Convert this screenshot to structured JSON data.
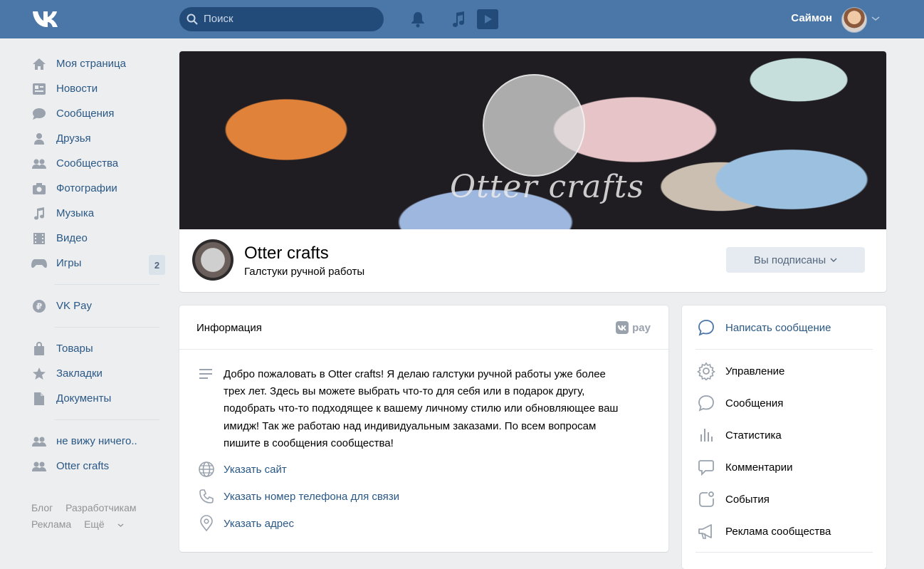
{
  "topbar": {
    "search_placeholder": "Поиск",
    "user_name": "Саймон"
  },
  "sidebar": {
    "items": [
      {
        "label": "Моя страница",
        "icon": "home-icon"
      },
      {
        "label": "Новости",
        "icon": "news-icon"
      },
      {
        "label": "Сообщения",
        "icon": "messages-icon"
      },
      {
        "label": "Друзья",
        "icon": "friend-icon"
      },
      {
        "label": "Сообщества",
        "icon": "groups-icon"
      },
      {
        "label": "Фотографии",
        "icon": "camera-icon"
      },
      {
        "label": "Музыка",
        "icon": "music-icon"
      },
      {
        "label": "Видео",
        "icon": "video-icon"
      },
      {
        "label": "Игры",
        "icon": "gamepad-icon",
        "badge": "2"
      }
    ],
    "pay": {
      "label": "VK Pay",
      "icon": "vkpay-icon"
    },
    "items2": [
      {
        "label": "Товары",
        "icon": "bag-icon"
      },
      {
        "label": "Закладки",
        "icon": "star-icon"
      },
      {
        "label": "Документы",
        "icon": "document-icon"
      }
    ],
    "communities": [
      {
        "label": "не вижу ничего..",
        "icon": "groups-icon"
      },
      {
        "label": "Otter crafts",
        "icon": "groups-icon"
      }
    ],
    "footer": {
      "blog": "Блог",
      "developers": "Разработчикам",
      "ads": "Реклама",
      "more": "Ещё"
    }
  },
  "group": {
    "cover_text": "Otter crafts",
    "title": "Otter crafts",
    "subtitle": "Галстуки ручной работы",
    "subscribed_button": "Вы подписаны"
  },
  "info": {
    "title": "Информация",
    "vkpay_label": "pay",
    "description": "Добро пожаловать в Otter crafts! Я делаю галстуки ручной работы уже более трех лет. Здесь вы можете выбрать что-то для себя или в подарок другу, подобрать что-то подходящее к вашему личному стилю или обновляющее ваш имидж! Так же работаю над индивидуальным заказами. По всем вопросам пишите в сообщения сообщества!",
    "website_link": "Указать сайт",
    "phone_link": "Указать номер телефона для связи",
    "address_link": "Указать адрес"
  },
  "actions": {
    "write_message": "Написать сообщение",
    "items": [
      {
        "label": "Управление",
        "icon": "gear-icon"
      },
      {
        "label": "Сообщения",
        "icon": "chat-icon"
      },
      {
        "label": "Статистика",
        "icon": "stats-icon"
      },
      {
        "label": "Комментарии",
        "icon": "comment-icon"
      },
      {
        "label": "События",
        "icon": "events-icon"
      },
      {
        "label": "Реклама сообщества",
        "icon": "megaphone-icon"
      }
    ]
  },
  "colors": {
    "header_bg": "#4a76a8",
    "page_bg": "#edeef0",
    "link": "#2a5885",
    "icon": "#99a2ad"
  }
}
